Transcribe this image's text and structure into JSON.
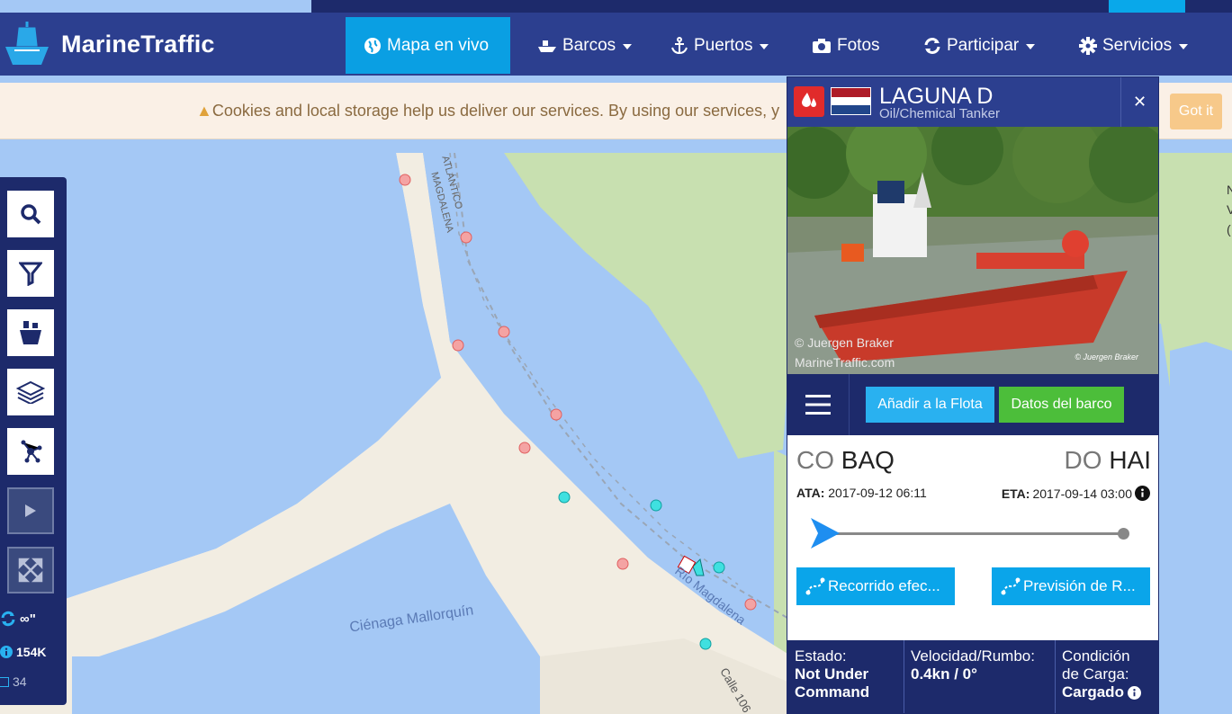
{
  "nav": {
    "logo_text": "MarineTraffic",
    "items": [
      {
        "label": "Mapa en vivo",
        "icon": "globe-icon"
      },
      {
        "label": "Barcos",
        "icon": "ship-icon"
      },
      {
        "label": "Puertos",
        "icon": "anchor-icon"
      },
      {
        "label": "Fotos",
        "icon": "camera-icon"
      },
      {
        "label": "Participar",
        "icon": "sync-icon"
      },
      {
        "label": "Servicios",
        "icon": "gear-icon"
      }
    ]
  },
  "cookie": {
    "text": "Cookies and local storage help us deliver our services. By using our services, y",
    "button": "Got it"
  },
  "toolbar": {
    "refresh_value": "∞\"",
    "vessel_count": "154K",
    "checked_count": "34"
  },
  "map_labels": {
    "cienaga": "Ciénaga Mallorquín",
    "rio": "Río Magdalena",
    "calle": "Calle 106",
    "magdalena": "MAGDALENA",
    "atlantico": "ATLÁNTICO"
  },
  "right_edge": [
    "N",
    "V",
    "("
  ],
  "vessel": {
    "name": "LAGUNA D",
    "type": "Oil/Chemical Tanker",
    "flag_colors": [
      "#ae1c28",
      "#ffffff",
      "#21468b"
    ],
    "photo_credit": "© Juergen Braker",
    "photo_site": "MarineTraffic.com",
    "photo_signature": "© Juergen Braker",
    "add_fleet": "Añadir a la Flota",
    "vessel_data": "Datos del barco",
    "from_country": "CO",
    "from_port": "BAQ",
    "to_country": "DO",
    "to_port": "HAI",
    "ata_label": "ATA:",
    "ata_value": "2017-09-12 06:11",
    "eta_label": "ETA:",
    "eta_value": "2017-09-14 03:00",
    "progress": 0.0,
    "track_past": "Recorrido efec...",
    "track_forecast": "Previsión de R...",
    "status_label": "Estado:",
    "status_value_1": "Not Under",
    "status_value_2": "Command",
    "speed_label": "Velocidad/Rumbo:",
    "speed_value": "0.4kn / 0°",
    "load_label_1": "Condición",
    "load_label_2": "de Carga:",
    "load_value": "Cargado"
  }
}
